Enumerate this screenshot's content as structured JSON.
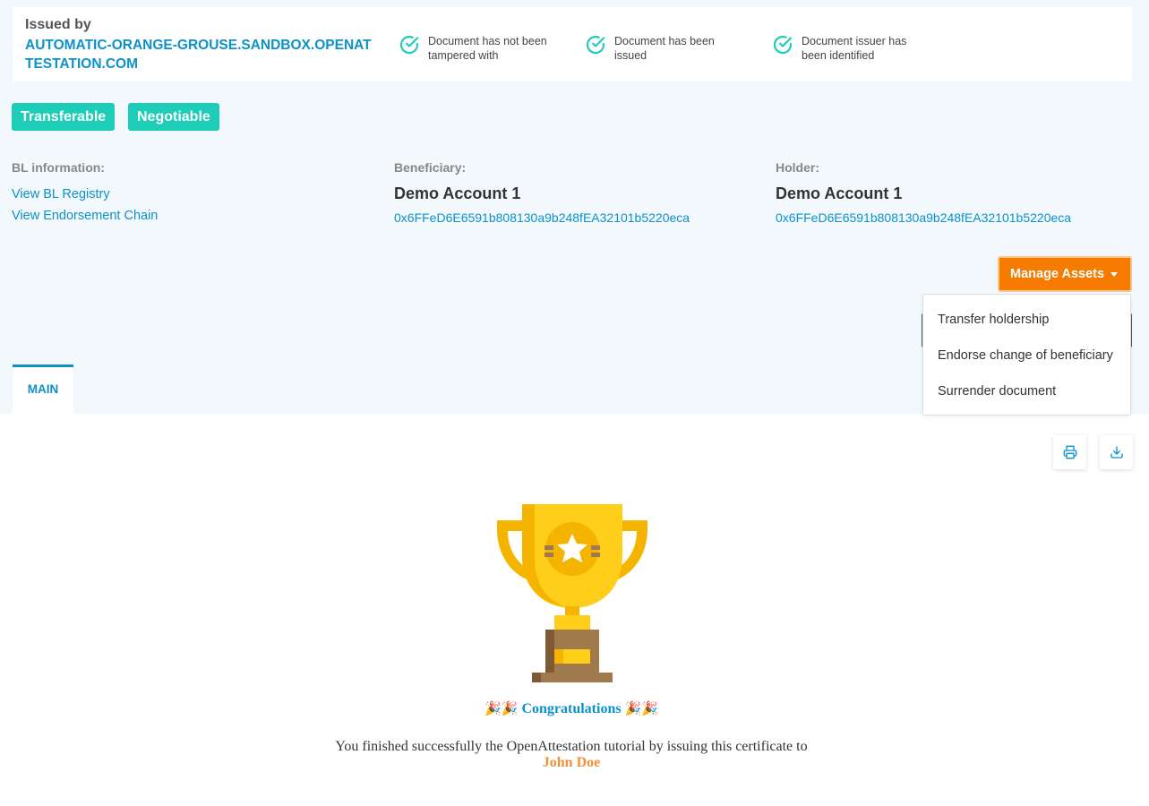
{
  "issuer": {
    "label": "Issued by",
    "domain": "AUTOMATIC-ORANGE-GROUSE.SANDBOX.OPENATTESTATION.COM"
  },
  "checks": [
    {
      "text": "Document has not been tampered with",
      "icon": "check-circle-icon"
    },
    {
      "text": "Document has been issued",
      "icon": "check-circle-icon"
    },
    {
      "text": "Document issuer has been identified",
      "icon": "check-circle-icon"
    }
  ],
  "tags": [
    "Transferable",
    "Negotiable"
  ],
  "bl_info": {
    "label": "BL information:",
    "links": [
      "View BL Registry",
      "View Endorsement Chain"
    ]
  },
  "beneficiary": {
    "label": "Beneficiary:",
    "name": "Demo Account 1",
    "address": "0x6FFeD6E6591b808130a9b248fEA32101b5220eca"
  },
  "holder": {
    "label": "Holder:",
    "name": "Demo Account 1",
    "address": "0x6FFeD6E6591b808130a9b248fEA32101b5220eca"
  },
  "manage_assets": {
    "label": "Manage Assets",
    "options": [
      "Transfer holdership",
      "Endorse change of beneficiary",
      "Surrender document"
    ]
  },
  "tabs": [
    "MAIN"
  ],
  "toolbar": {
    "print_icon": "printer-icon",
    "download_icon": "download-icon"
  },
  "certificate": {
    "party_emoji": "🎉🎉",
    "congrats": "Congratulations",
    "message": "You finished successfully the OpenAttestation tutorial by issuing this certificate to",
    "recipient": "John Doe"
  },
  "colors": {
    "accent": "#0c92c9",
    "tag": "#1ecdb8",
    "manage_button": "#f57c00",
    "recipient": "#f0903a",
    "check": "#1ecdb8"
  }
}
